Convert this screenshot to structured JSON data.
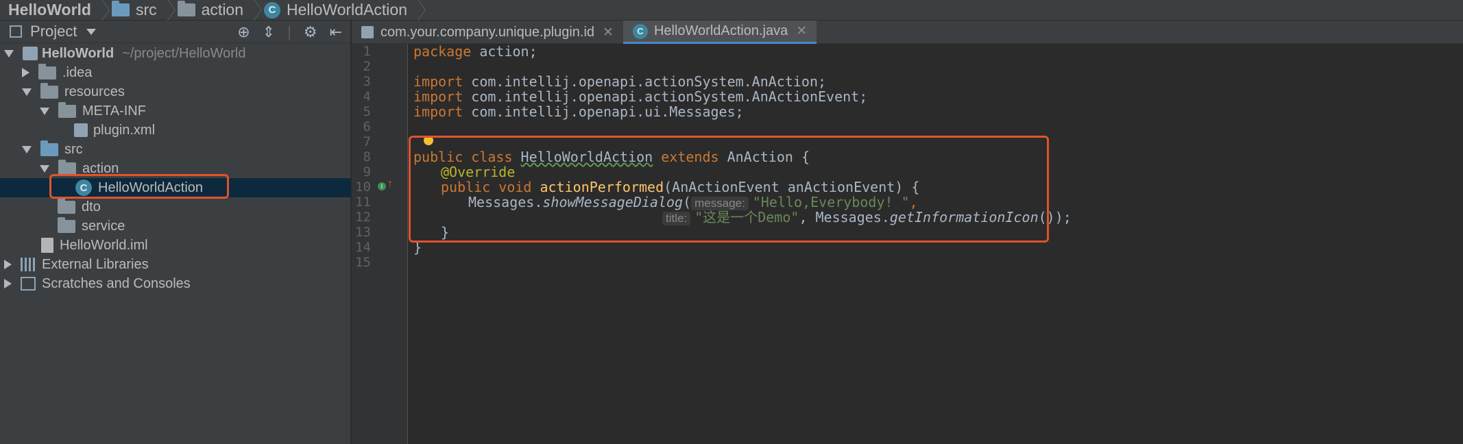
{
  "breadcrumb": {
    "project": "HelloWorld",
    "folder1": "src",
    "folder2": "action",
    "file": "HelloWorldAction"
  },
  "panel": {
    "title": "Project",
    "tree": [
      {
        "label": "HelloWorld",
        "hint": "~/project/HelloWorld"
      },
      {
        "label": ".idea"
      },
      {
        "label": "resources"
      },
      {
        "label": "META-INF"
      },
      {
        "label": "plugin.xml"
      },
      {
        "label": "src"
      },
      {
        "label": "action"
      },
      {
        "label": "HelloWorldAction"
      },
      {
        "label": "dto"
      },
      {
        "label": "service"
      },
      {
        "label": "HelloWorld.iml"
      },
      {
        "label": "External Libraries"
      },
      {
        "label": "Scratches and Consoles"
      }
    ]
  },
  "tabs": [
    {
      "label": "com.your.company.unique.plugin.id"
    },
    {
      "label": "HelloWorldAction.java"
    }
  ],
  "editor": {
    "line_numbers": [
      "1",
      "2",
      "3",
      "4",
      "5",
      "6",
      "7",
      "8",
      "9",
      "10",
      "11",
      "12",
      "13",
      "14",
      "15"
    ],
    "code": {
      "l1_kw": "package",
      "l1_rest": " action;",
      "l3_kw": "import",
      "l3_rest": " com.intellij.openapi.actionSystem.AnAction;",
      "l4_kw": "import",
      "l4_rest": " com.intellij.openapi.actionSystem.AnActionEvent;",
      "l5_kw": "import",
      "l5_rest": " com.intellij.openapi.ui.Messages;",
      "l8_kw1": "public class ",
      "l8_name": "HelloWorldAction",
      "l8_kw2": " extends ",
      "l8_rest": "AnAction {",
      "l9_ann": "@Override",
      "l10_kw": "public void ",
      "l10_fn": "actionPerformed",
      "l10_rest": "(AnActionEvent anActionEvent) {",
      "l11_obj": "Messages.",
      "l11_fn": "showMessageDialog",
      "l11_paren": "(",
      "l11_hint": "message:",
      "l11_str": "\"Hello,Everybody! \"",
      "l11_end": ",",
      "l12_hint": "title:",
      "l12_str": "\"这是一个Demo\"",
      "l12_mid": ", Messages.",
      "l12_fn": "getInformationIcon",
      "l12_end": "());",
      "l13": "}",
      "l14": "}"
    }
  }
}
